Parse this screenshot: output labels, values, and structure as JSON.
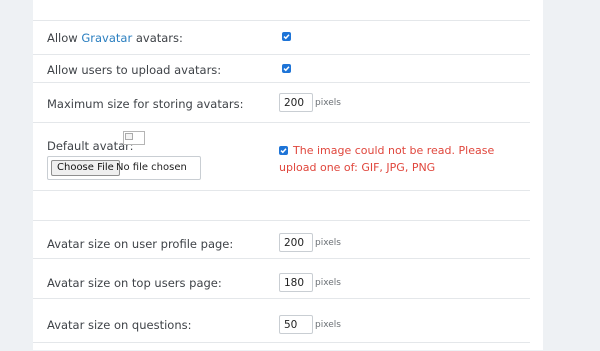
{
  "options": {
    "allow_gravatar": {
      "label_prefix": "Allow ",
      "label_link": "Gravatar",
      "label_suffix": " avatars:",
      "checked": true
    },
    "allow_upload": {
      "label": "Allow users to upload avatars:",
      "checked": true
    },
    "max_size": {
      "label": "Maximum size for storing avatars:",
      "value": "200",
      "unit": "pixels"
    },
    "default_avatar": {
      "label": "Default avatar:",
      "file_button": "Choose File",
      "file_status": "No file chosen",
      "error_checked": true,
      "error_message": "The image could not be read. Please upload one of: GIF, JPG, PNG"
    },
    "profile_size": {
      "label": "Avatar size on user profile page:",
      "value": "200",
      "unit": "pixels"
    },
    "top_users_size": {
      "label": "Avatar size on top users page:",
      "value": "180",
      "unit": "pixels"
    },
    "questions_size": {
      "label": "Avatar size on questions:",
      "value": "50",
      "unit": "pixels"
    }
  },
  "colors": {
    "accent": "#1e74d7",
    "link": "#2b7fc0",
    "error": "#e0463c",
    "page_background": "#eef1f4"
  }
}
